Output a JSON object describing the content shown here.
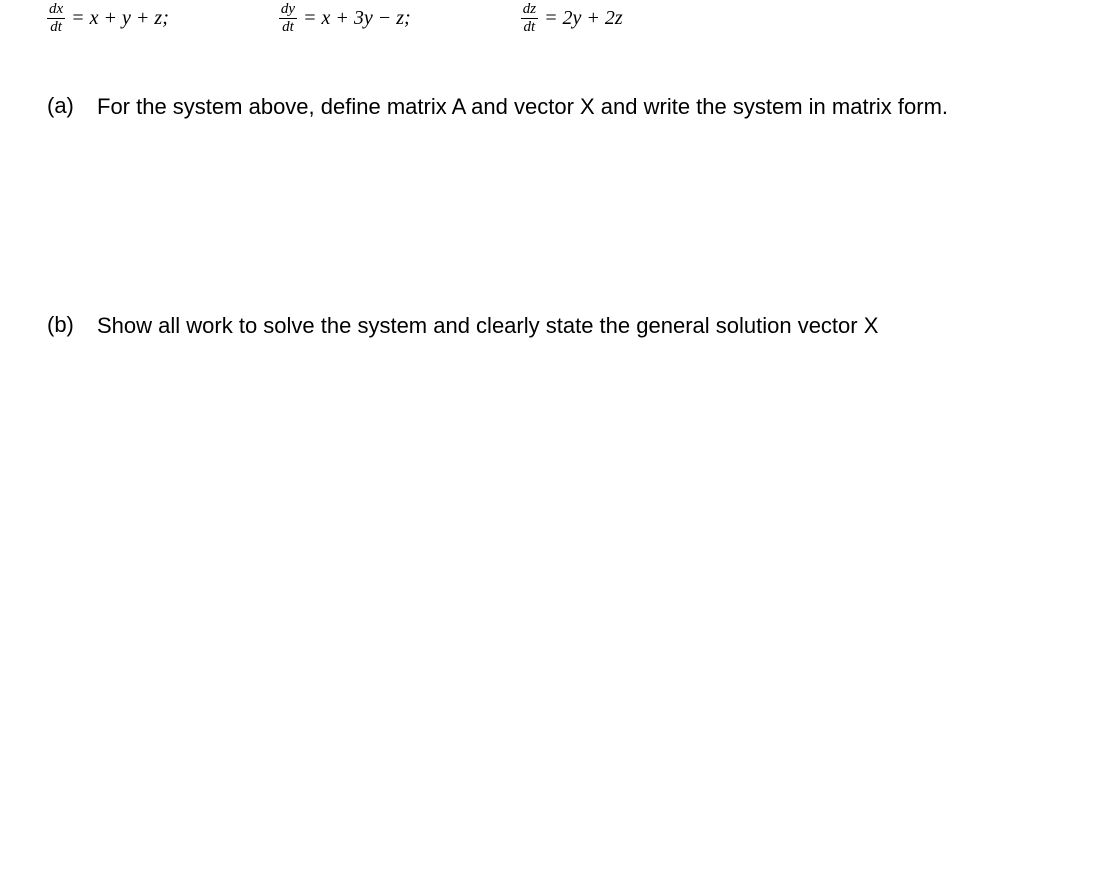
{
  "equations": {
    "eq1": {
      "numerator": "dx",
      "denominator": "dt",
      "body": "= x + y + z;"
    },
    "eq2": {
      "numerator": "dy",
      "denominator": "dt",
      "body": "= x + 3y − z;"
    },
    "eq3": {
      "numerator": "dz",
      "denominator": "dt",
      "body": "= 2y + 2z"
    }
  },
  "parts": {
    "a": {
      "label": "(a)",
      "text": "For the system above, define matrix A and vector X and write the system in matrix form."
    },
    "b": {
      "label": "(b)",
      "text": "Show all work to solve the system and clearly state the general solution vector X"
    }
  }
}
